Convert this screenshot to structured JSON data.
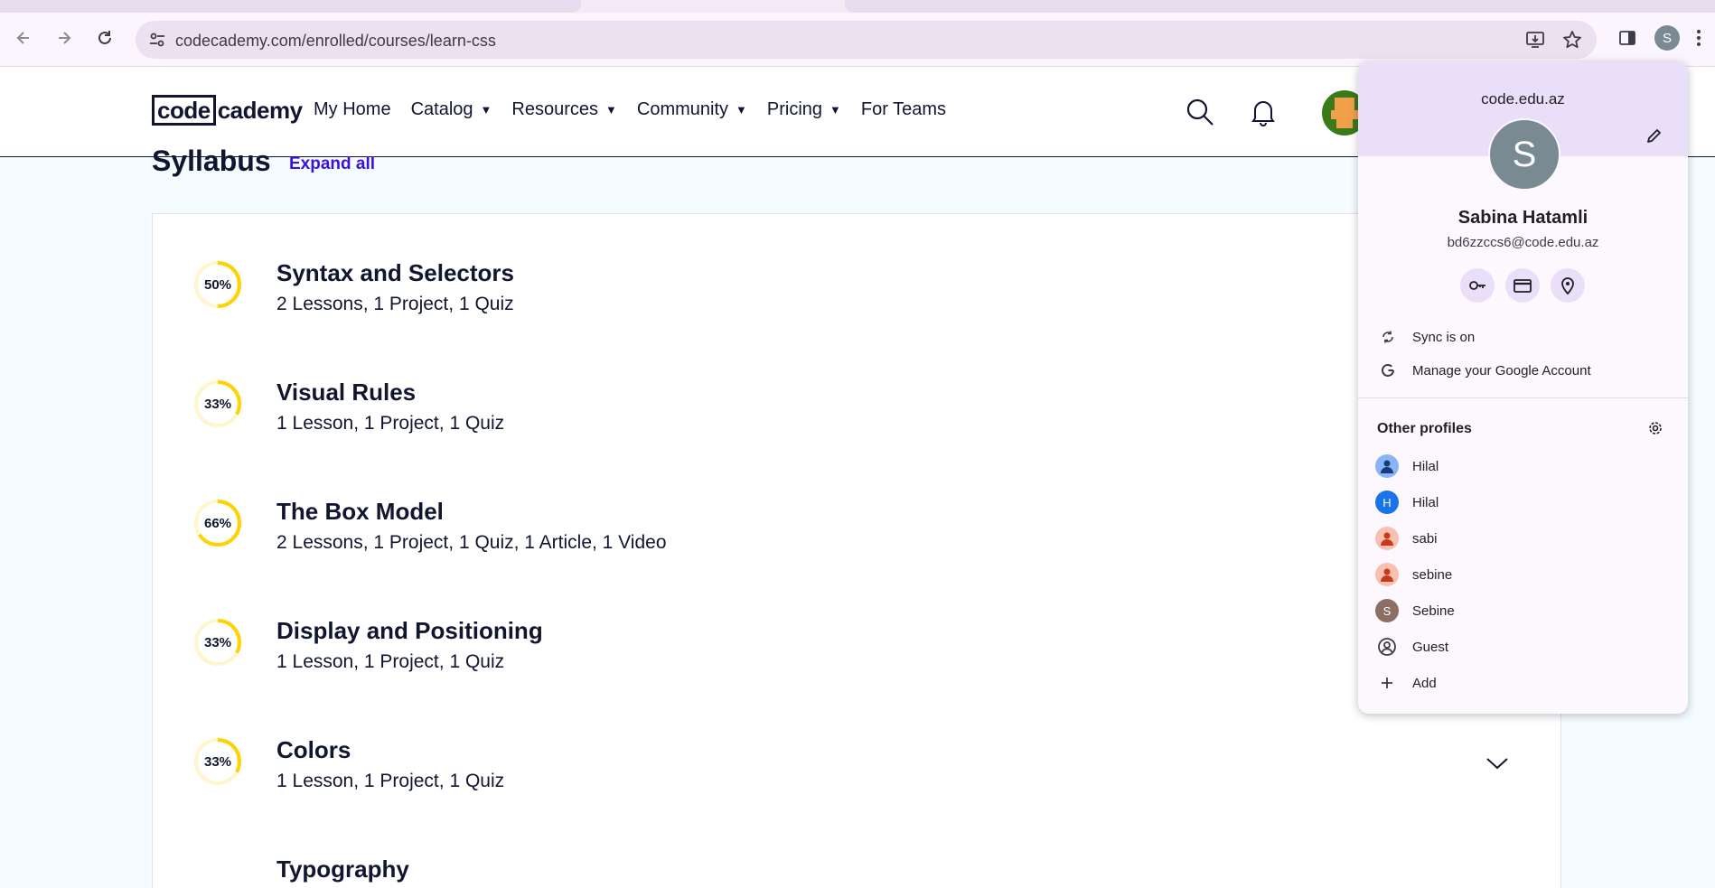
{
  "browser": {
    "url": "codecademy.com/enrolled/courses/learn-css",
    "profile_initial": "S"
  },
  "site": {
    "logo_boxed": "code",
    "logo_rest": "cademy",
    "nav": [
      {
        "label": "My Home",
        "dropdown": false
      },
      {
        "label": "Catalog",
        "dropdown": true
      },
      {
        "label": "Resources",
        "dropdown": true
      },
      {
        "label": "Community",
        "dropdown": true
      },
      {
        "label": "Pricing",
        "dropdown": true
      },
      {
        "label": "For Teams",
        "dropdown": false
      }
    ],
    "caret": "▼"
  },
  "syllabus": {
    "title": "Syllabus",
    "expand_all": "Expand all",
    "modules": [
      {
        "title": "Syntax and Selectors",
        "summary": "2 Lessons, 1 Project, 1 Quiz",
        "progress_label": "50%",
        "progress": 0.5
      },
      {
        "title": "Visual Rules",
        "summary": "1 Lesson, 1 Project, 1 Quiz",
        "progress_label": "33%",
        "progress": 0.33
      },
      {
        "title": "The Box Model",
        "summary": "2 Lessons, 1 Project, 1 Quiz, 1 Article, 1 Video",
        "progress_label": "66%",
        "progress": 0.66
      },
      {
        "title": "Display and Positioning",
        "summary": "1 Lesson, 1 Project, 1 Quiz",
        "progress_label": "33%",
        "progress": 0.33
      },
      {
        "title": "Colors",
        "summary": "1 Lesson, 1 Project, 1 Quiz",
        "progress_label": "33%",
        "progress": 0.33
      },
      {
        "title": "Typography",
        "summary": "",
        "progress_label": "",
        "progress": 0
      }
    ]
  },
  "profile_panel": {
    "domain": "code.edu.az",
    "avatar_initial": "S",
    "name": "Sabina Hatamli",
    "email": "bd6zzccs6@code.edu.az",
    "quick_actions": [
      "passwords-key-icon",
      "payment-card-icon",
      "addresses-pin-icon"
    ],
    "sync_label": "Sync is on",
    "manage_label": "Manage your Google Account",
    "other_profiles_label": "Other profiles",
    "profiles": [
      {
        "name": "Hilal",
        "initial": "",
        "color": "#8ab4f8",
        "icon": "person-icon"
      },
      {
        "name": "Hilal",
        "initial": "H",
        "color": "#1a73e8",
        "icon": "letter-avatar"
      },
      {
        "name": "sabi",
        "initial": "",
        "color": "#f6c1b0",
        "icon": "person-icon"
      },
      {
        "name": "sebine",
        "initial": "",
        "color": "#f6c1b0",
        "icon": "person-icon"
      },
      {
        "name": "Sebine",
        "initial": "S",
        "color": "#8d6e63",
        "icon": "letter-avatar"
      },
      {
        "name": "Guest",
        "initial": "",
        "color": "transparent",
        "icon": "guest-icon"
      },
      {
        "name": "Add",
        "initial": "",
        "color": "transparent",
        "icon": "plus-icon"
      }
    ]
  },
  "colors": {
    "accent": "#3a10e5",
    "progress": "#ffd300",
    "progress_track": "#fff6cc",
    "page_bg": "#f5fcff",
    "ink": "#10162f"
  }
}
